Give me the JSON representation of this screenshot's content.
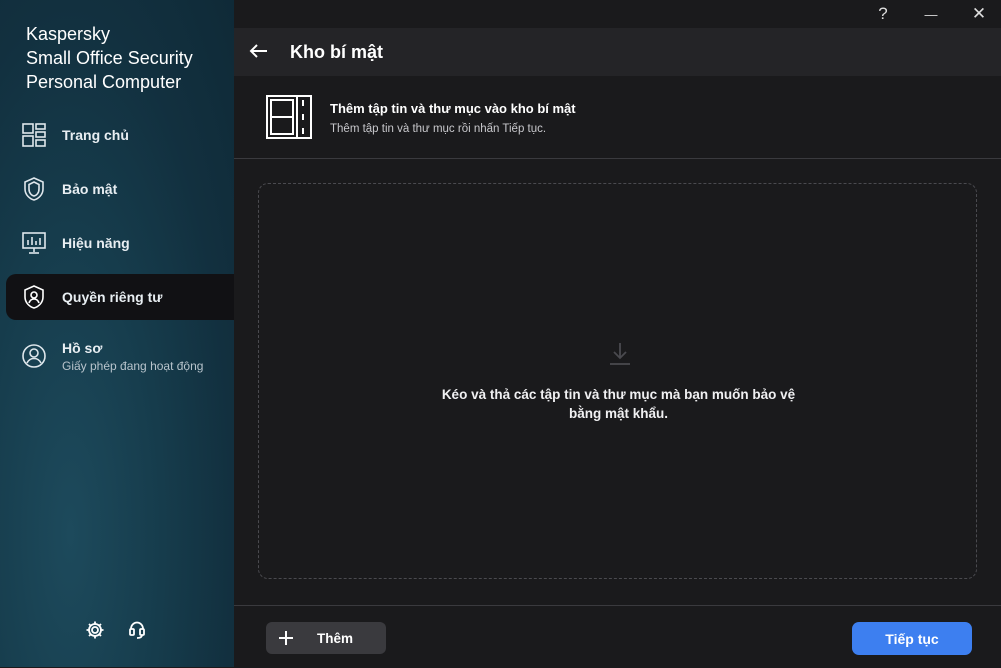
{
  "app": {
    "brand_line1": "Kaspersky",
    "brand_line2": "Small Office Security",
    "brand_line3": "Personal Computer"
  },
  "sidebar": {
    "items": [
      {
        "label": "Trang chủ",
        "icon": "dashboard-icon"
      },
      {
        "label": "Bảo mật",
        "icon": "shield-icon"
      },
      {
        "label": "Hiệu năng",
        "icon": "performance-monitor-icon"
      },
      {
        "label": "Quyền riêng tư",
        "icon": "privacy-shield-user-icon",
        "active": true
      },
      {
        "label": "Hồ sơ",
        "sub": "Giấy phép đang hoạt động",
        "icon": "profile-icon"
      }
    ],
    "bottom_icons": [
      "settings-gear-icon",
      "support-icon"
    ]
  },
  "titlebar": {
    "help": "?",
    "minimize": "—",
    "close": "✕"
  },
  "header": {
    "title": "Kho bí mật"
  },
  "info": {
    "title": "Thêm tập tin và thư mục vào kho bí mật",
    "subtitle": "Thêm tập tin và thư mục rồi nhấn Tiếp tục."
  },
  "dropzone": {
    "line1": "Kéo và thả các tập tin và thư mục mà bạn muốn bảo vệ",
    "line2": "bằng mật khẩu."
  },
  "footer": {
    "add_label": "Thêm",
    "continue_label": "Tiếp tục"
  },
  "colors": {
    "accent": "#3d7ff0",
    "background": "#1a1a1c",
    "sidebar": "#163c4c"
  }
}
